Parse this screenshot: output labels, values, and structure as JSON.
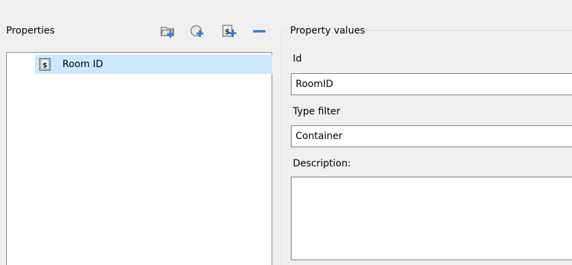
{
  "properties_panel": {
    "title": "Properties",
    "toolbar": [
      {
        "name": "add-folder-icon",
        "accent": "#2d7fd8"
      },
      {
        "name": "add-circle-icon",
        "accent": "#2d7fd8"
      },
      {
        "name": "add-string-property-icon",
        "accent": "#2d7fd8"
      },
      {
        "name": "remove-icon",
        "accent": "#2d7fd8"
      }
    ],
    "items": [
      {
        "label": "Room ID",
        "icon": "string-property-icon",
        "selected": true
      }
    ]
  },
  "property_values": {
    "title": "Property values",
    "id_label": "Id",
    "id_value": "RoomID",
    "type_filter_label": "Type filter",
    "type_filter_value": "Container",
    "description_label": "Description:",
    "description_value": ""
  },
  "colors": {
    "selection": "#cce8ff",
    "accent": "#2d7fd8",
    "background": "#f0f0f0"
  }
}
